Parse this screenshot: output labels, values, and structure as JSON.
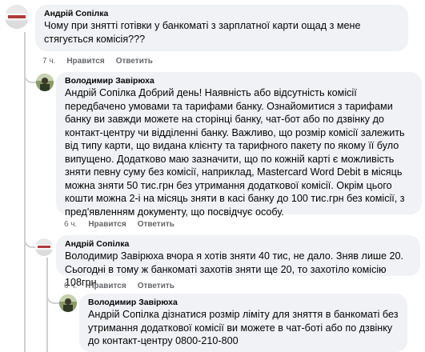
{
  "comments": [
    {
      "author": "Андрій Сопілка",
      "text": "Чому при знятті готівки у банкоматі з зарплатної карти ощад з мене стягується комісія???",
      "time": "7 ч.",
      "like_label": "Нравится",
      "reply_label": "Ответить"
    },
    {
      "author": "Володимир Завірюха",
      "mention": "Андрій Сопілка",
      "text": " Добрий день! Наявність або відсутність комісії передбачено умовами та тарифами банку. Ознайомитися з тарифами банку ви завжди можете на сторінці банку, чат-бот або по дзвінку до контакт-центру чи відділенні банку. Важливо, що розмір комісії залежить від типу карти, що видана клієнту та тарифного пакету по якому її було випущено. Додатково маю зазначити, що по кожній карті є можливість зняти певну суму без комісії, наприклад, Mastercard Word Debit в місяць можна зняти 50 тис.грн без утримання додаткової комісії. Окрім цього кошти можна 2-і на місяць зняти в касі банку до 100 тис.грн без комісії, з пред'явленням документу, що посвідчує особу.",
      "time": "6 ч.",
      "like_label": "Нравится",
      "reply_label": "Ответить"
    },
    {
      "author": "Андрій Сопілка",
      "mention": "Володимир Завірюха",
      "text": " вчора я хотів зняти 40 тис, не дало. Зняв лише 20. Сьогодні в тому ж банкоматі захотів зняти ще 20, то захотіло комісію 108грн.",
      "time": "6 ч.",
      "like_label": "Нравится",
      "reply_label": "Ответить"
    },
    {
      "author": "Володимир Завірюха",
      "mention": "Андрій Сопілка",
      "text": " дізнатися розмір ліміту для зняття в банкоматі без утримання додаткової комісії ви можете в чат-боті або по дзвінку до контакт-центру 0800-210-800"
    }
  ]
}
